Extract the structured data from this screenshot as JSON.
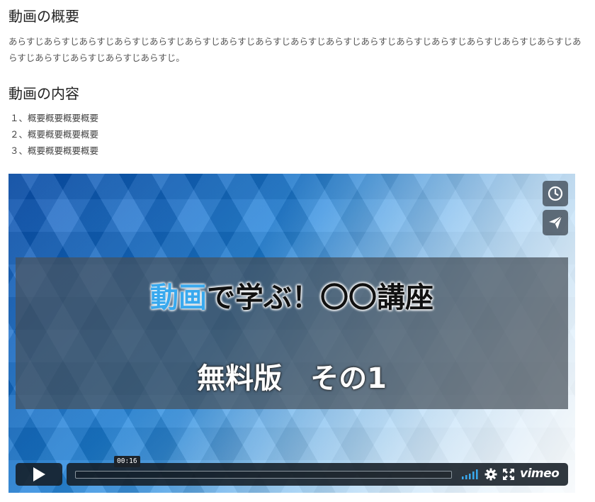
{
  "sections": {
    "summary_heading": "動画の概要",
    "summary_text": "あらすじあらすじあらすじあらすじあらすじあらすじあらすじあらすじあらすじあらすじあらすじあらすじあらすじあらすじあらすじあらすじあらすじあらすじあらすじあらすじあらすじ。",
    "content_heading": "動画の内容",
    "content_items": [
      "１、概要概要概要概要",
      "２、概要概要概要概要",
      "３、概要概要概要概要"
    ]
  },
  "video": {
    "title_accent": "動画",
    "title_rest": "で学ぶ！〇〇講座",
    "subtitle": "無料版　その1",
    "timestamp": "00:16",
    "progress": 0.0,
    "brand": "vimeo",
    "accent_color": "#39a9ee"
  }
}
